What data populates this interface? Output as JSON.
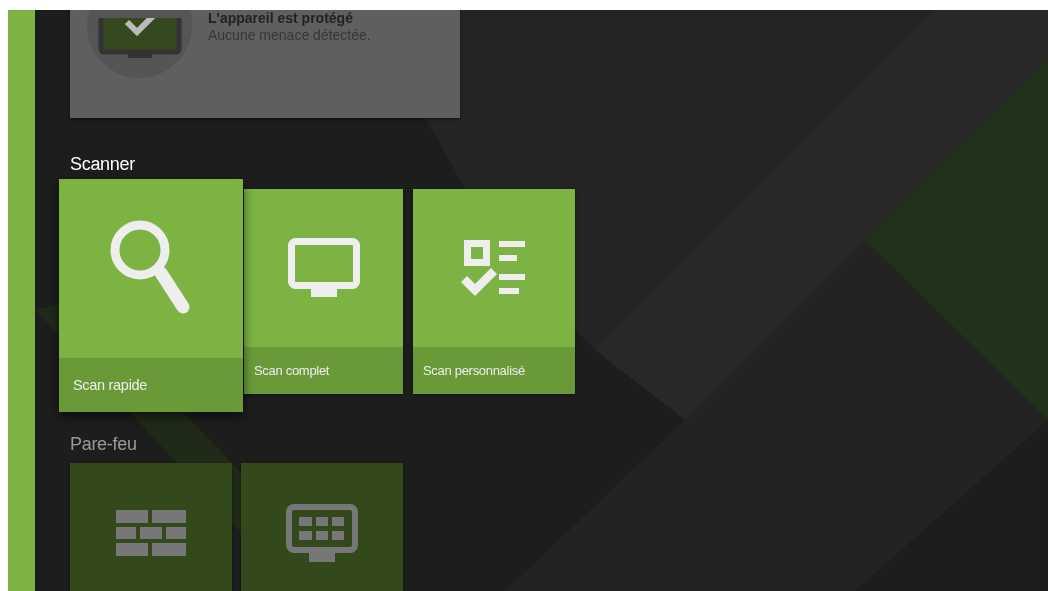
{
  "status_card": {
    "title": "L'appareil est protégé",
    "subtitle": "Aucune menace détectée.",
    "dimmed": true
  },
  "sections": [
    {
      "heading": "Scanner",
      "dimmed": false,
      "tiles": [
        {
          "kind": "search",
          "label": "Scan rapide",
          "selected": true
        },
        {
          "kind": "monitor",
          "label": "Scan complet",
          "selected": false
        },
        {
          "kind": "checklist",
          "label": "Scan personnalisé",
          "selected": false
        }
      ]
    },
    {
      "heading": "Pare-feu",
      "dimmed": true,
      "tiles": [
        {
          "kind": "wall",
          "selected": false
        },
        {
          "kind": "monitor-grid",
          "selected": false
        }
      ]
    }
  ]
}
